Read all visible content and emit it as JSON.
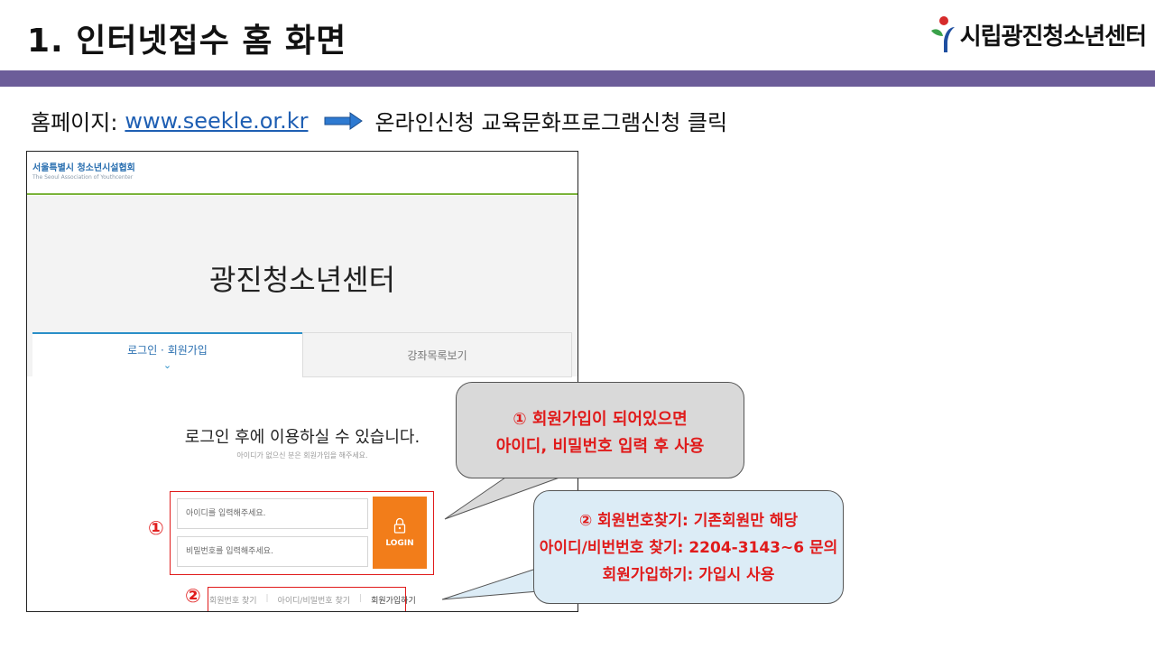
{
  "slide": {
    "title": "1. 인터넷접수 홈 화면",
    "logo_text": "시립광진청소년센터",
    "intro_label": "홈페이지:",
    "intro_link": "www.seekle.or.kr",
    "intro_action": "온라인신청 교육문화프로그램신청 클릭",
    "accent_color": "#6c5d99"
  },
  "site": {
    "org_name": "서울특별시 청소년시설협회",
    "org_subtitle": "The Seoul Association of Youthcenter",
    "hero_title": "광진청소년센터",
    "tabs": [
      {
        "label": "로그인 · 회원가입",
        "active": true
      },
      {
        "label": "강좌목록보기",
        "active": false
      }
    ],
    "login_message": "로그인 후에 이용하실 수 있습니다.",
    "login_submessage": "아이디가 없으신 분은 회원가입을 해주세요.",
    "id_placeholder": "아이디를 입력해주세요.",
    "pw_placeholder": "비밀번호를 입력해주세요.",
    "login_button": "LOGIN",
    "links": [
      "회원번호 찾기",
      "아이디/비밀번호 찾기",
      "회원가입하기"
    ],
    "brand_orange": "#f27d1a"
  },
  "annotations": {
    "marker1": "①",
    "marker2": "②",
    "callout1": [
      "① 회원가입이 되어있으면",
      "아이디, 비밀번호 입력 후 사용"
    ],
    "callout2": [
      "② 회원번호찾기: 기존회원만 해당",
      "아이디/비번번호 찾기: 2204-3143~6 문의",
      "회원가입하기: 가입시 사용"
    ],
    "highlight_color": "#e01b1b"
  }
}
